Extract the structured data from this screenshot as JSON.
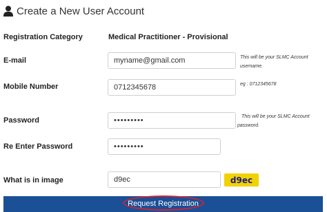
{
  "header": {
    "title": "Create a New User Account",
    "icon": "user-icon"
  },
  "form": {
    "category": {
      "label": "Registration Category",
      "value": "Medical Practitioner - Provisional"
    },
    "email": {
      "label": "E-mail",
      "value": "myname@gmail.com",
      "hint_line1": "This will be your SLMC Account",
      "hint_line2": "username."
    },
    "mobile": {
      "label": "Mobile Number",
      "value": "0712345678",
      "hint": "eg : 0712345678"
    },
    "password": {
      "label": "Password",
      "value": "•••••••••",
      "hint_line1": "This will be your SLMC Account",
      "hint_line2": "password."
    },
    "confirm_password": {
      "label": "Re Enter Password",
      "value": "•••••••••"
    },
    "captcha": {
      "label": "What is in image",
      "value": "d9ec",
      "image_text": "d9ec",
      "image_color": "#f2d100"
    },
    "submit": {
      "label": "Request Registration",
      "color": "#1b4f96",
      "highlight_color": "#d9232e"
    }
  }
}
